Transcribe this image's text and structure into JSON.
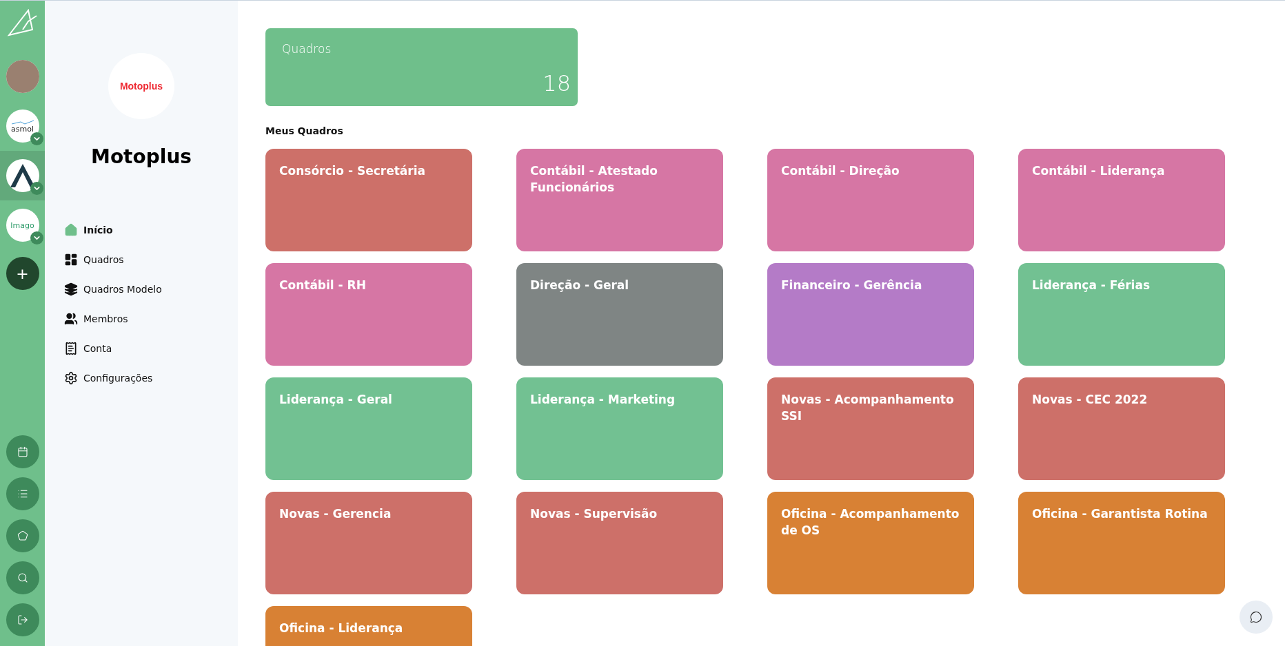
{
  "rail": {
    "workspaces": [
      {
        "kind": "photo",
        "selected": false,
        "has_menu": false
      },
      {
        "kind": "wave",
        "logo_text": "asmol",
        "selected": false,
        "has_menu": true
      },
      {
        "kind": "peak",
        "selected": true,
        "has_menu": true
      },
      {
        "kind": "leaf",
        "logo_text": "Imago",
        "selected": false,
        "has_menu": true
      }
    ],
    "add_label": "+",
    "tools": [
      {
        "kind": "calendar"
      },
      {
        "kind": "list"
      },
      {
        "kind": "badge"
      },
      {
        "kind": "search"
      },
      {
        "kind": "logout"
      }
    ]
  },
  "sidebar": {
    "logo_text": "Motoplus",
    "title": "Motoplus",
    "items": [
      {
        "kind": "home",
        "label": "Início",
        "selected": true
      },
      {
        "kind": "boards",
        "label": "Quadros",
        "selected": false
      },
      {
        "kind": "layers",
        "label": "Quadros Modelo",
        "selected": false
      },
      {
        "kind": "members",
        "label": "Membros",
        "selected": false
      },
      {
        "kind": "receipt",
        "label": "Conta",
        "selected": false
      },
      {
        "kind": "gear",
        "label": "Configurações",
        "selected": false
      }
    ]
  },
  "summary": {
    "label": "Quadros",
    "count": "18"
  },
  "section_title": "Meus Quadros",
  "boards": [
    {
      "title": "Consórcio - Secretária",
      "color": "#cd7069"
    },
    {
      "title": "Contábil - Atestado Funcionários",
      "color": "#d676a4"
    },
    {
      "title": "Contábil - Direção",
      "color": "#d676a4"
    },
    {
      "title": "Contábil - Liderança",
      "color": "#d676a4"
    },
    {
      "title": "Contábil - RH",
      "color": "#d676a4"
    },
    {
      "title": "Direção - Geral",
      "color": "#7f8584"
    },
    {
      "title": "Financeiro - Gerência",
      "color": "#b47bc7"
    },
    {
      "title": "Liderança - Férias",
      "color": "#72c192"
    },
    {
      "title": "Liderança - Geral",
      "color": "#72c192"
    },
    {
      "title": "Liderança - Marketing",
      "color": "#72c192"
    },
    {
      "title": "Novas - Acompanhamento SSI",
      "color": "#cd7069"
    },
    {
      "title": "Novas - CEC 2022",
      "color": "#cd7069"
    },
    {
      "title": "Novas - Gerencia",
      "color": "#cd7069"
    },
    {
      "title": "Novas - Supervisão",
      "color": "#cd7069"
    },
    {
      "title": "Oficina - Acompanhamento de OS",
      "color": "#d88134"
    },
    {
      "title": "Oficina - Garantista Rotina",
      "color": "#d88134"
    },
    {
      "title": "Oficina - Liderança",
      "color": "#d88134"
    }
  ]
}
